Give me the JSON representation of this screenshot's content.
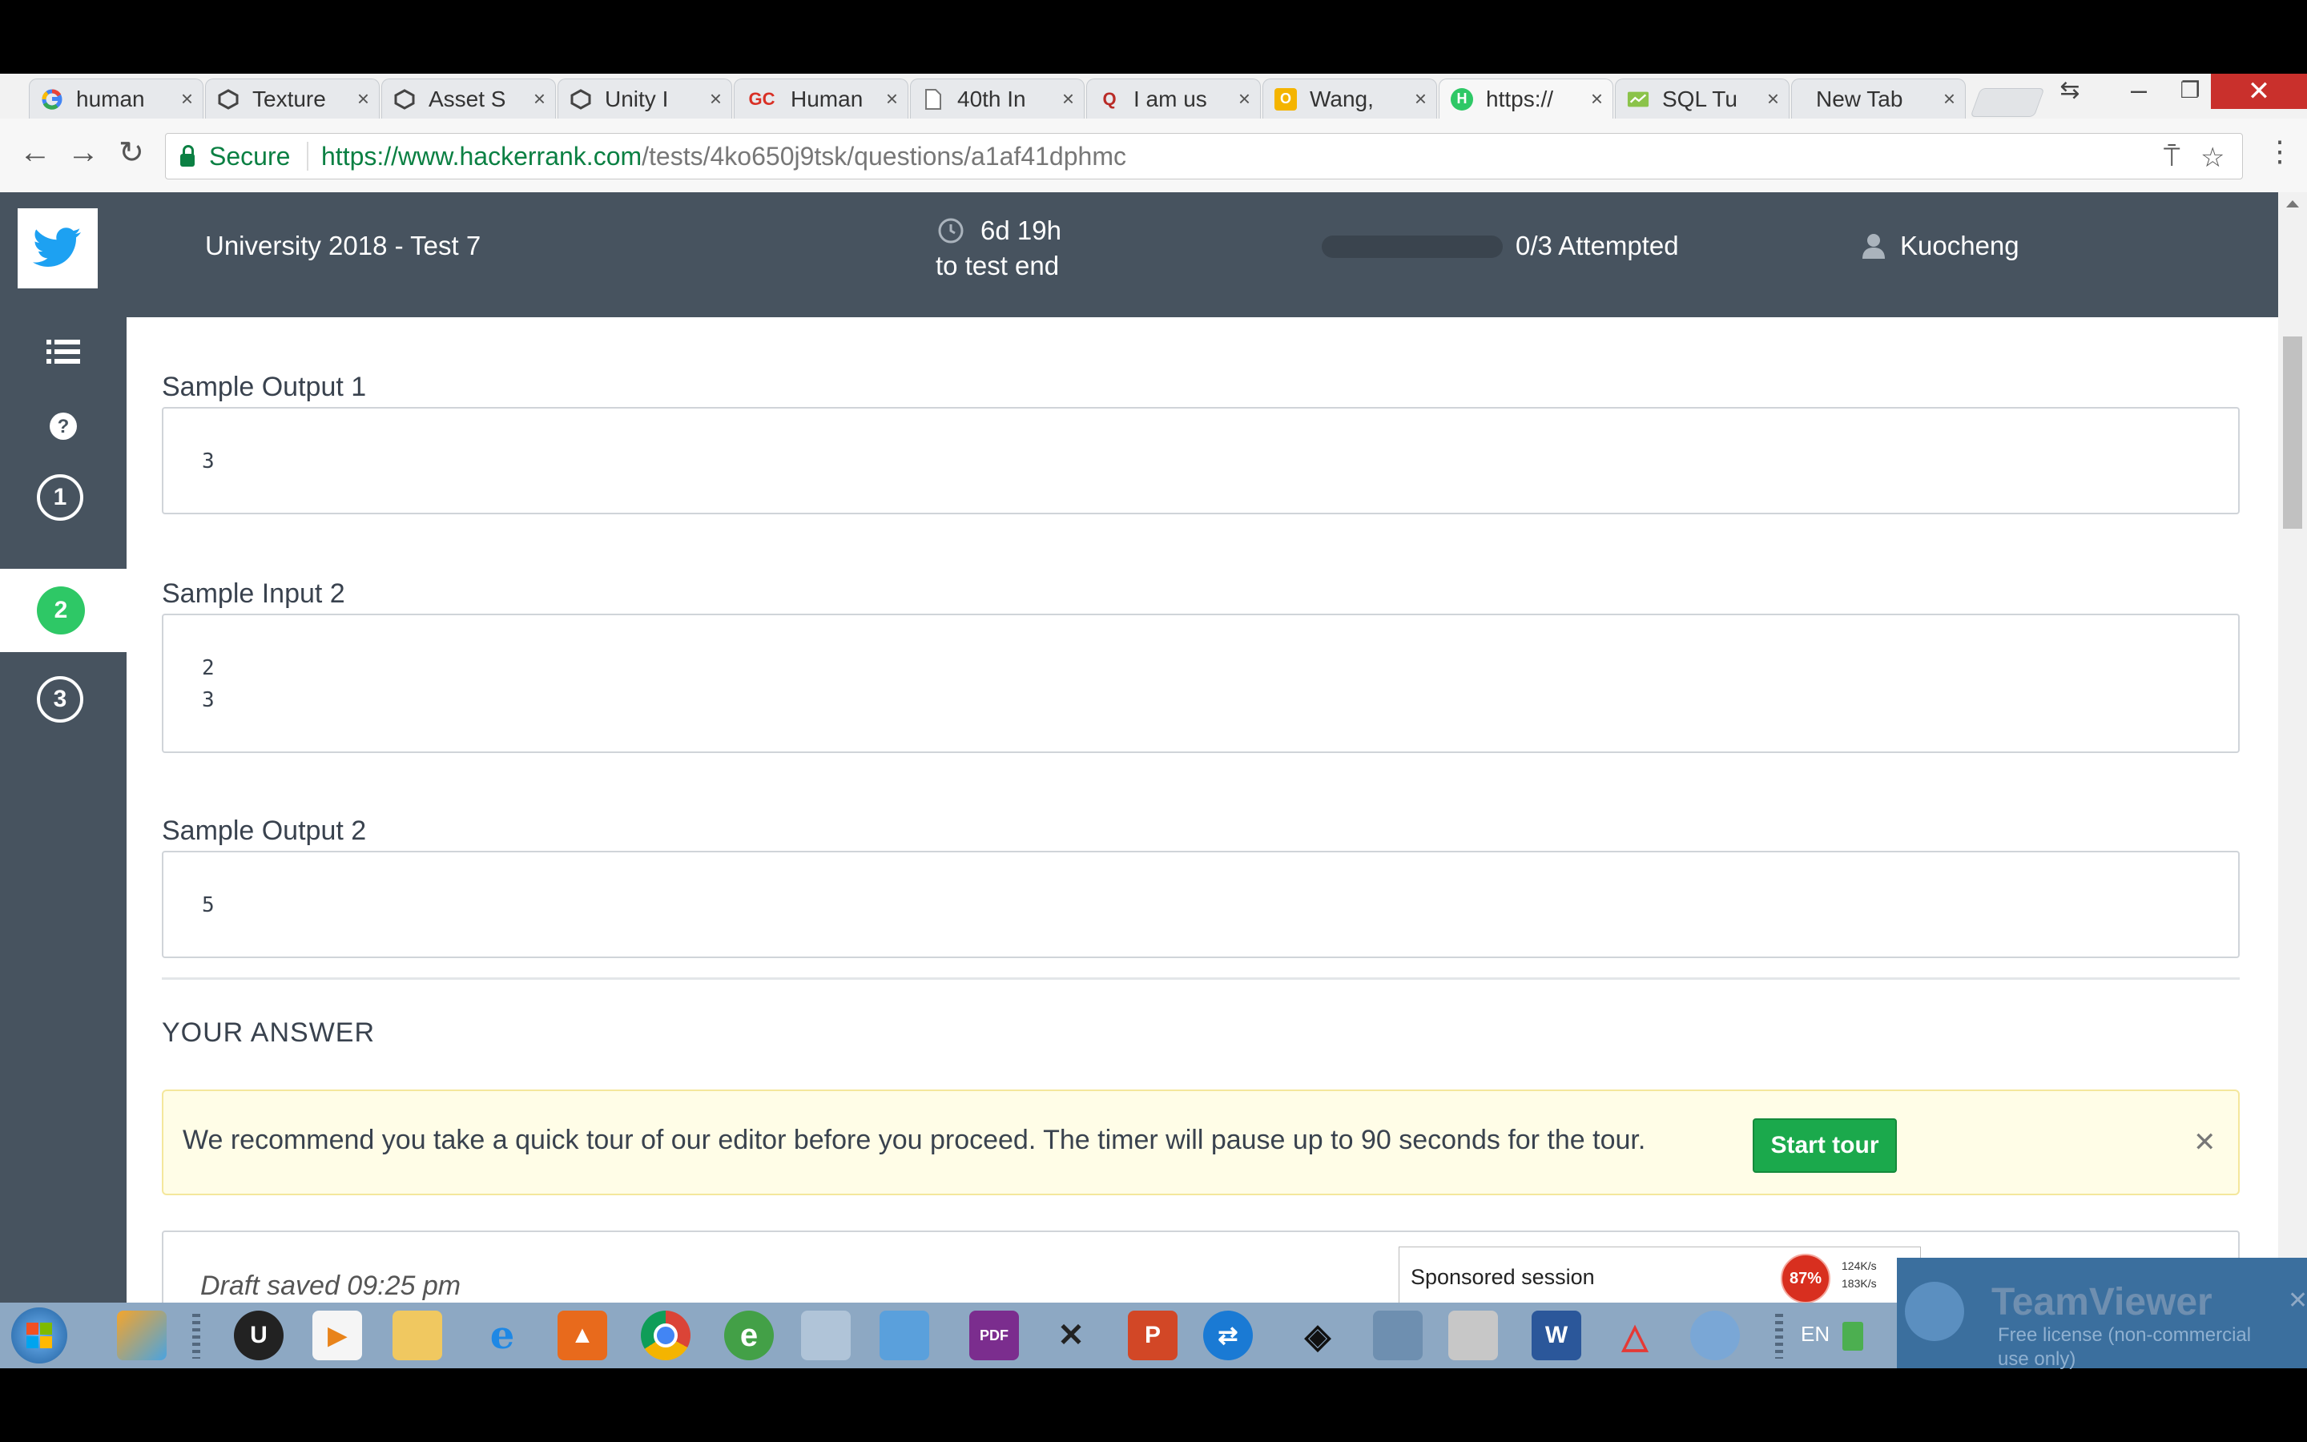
{
  "browser": {
    "tabs": [
      {
        "title": "human",
        "favicon": "google-icon"
      },
      {
        "title": "Texture",
        "favicon": "unity-icon"
      },
      {
        "title": "Asset S",
        "favicon": "unity-icon"
      },
      {
        "title": "Unity I",
        "favicon": "unity-icon"
      },
      {
        "title": "Human",
        "favicon": "gc-icon",
        "favicon_text": "GC"
      },
      {
        "title": "40th In",
        "favicon": "document-icon"
      },
      {
        "title": "I am us",
        "favicon": "quora-icon",
        "favicon_text": "Q"
      },
      {
        "title": "Wang,",
        "favicon": "outlook-icon",
        "favicon_text": "O"
      },
      {
        "title": "https://",
        "favicon": "hackerrank-icon",
        "favicon_text": "H",
        "active": true
      },
      {
        "title": "SQL Tu",
        "favicon": "sql-icon"
      },
      {
        "title": "New Tab",
        "favicon": ""
      }
    ],
    "close_glyph": "×",
    "security_label": "Secure",
    "url_domain": "https://www.hackerrank.com",
    "url_path": "/tests/4ko650j9tsk/questions/a1af41dphmc"
  },
  "header": {
    "test_title": "University 2018 - Test 7",
    "timer_value": "6d 19h",
    "timer_caption": "to test end",
    "progress": 0,
    "attempted": "0/3 Attempted",
    "username": "Kuocheng"
  },
  "sidebar": {
    "questions": [
      "1",
      "2",
      "3"
    ],
    "active_question": "2"
  },
  "content": {
    "sample_output_1": {
      "label": "Sample Output 1",
      "lines": [
        "3"
      ]
    },
    "sample_input_2": {
      "label": "Sample Input 2",
      "lines": [
        "2",
        "3"
      ]
    },
    "sample_output_2": {
      "label": "Sample Output 2",
      "lines": [
        "5"
      ]
    },
    "answer_heading": "YOUR ANSWER",
    "tour_message": "We recommend you take a quick tour of our editor before you proceed. The timer will pause up to 90 seconds for the tour.",
    "tour_button": "Start tour",
    "draft_status": "Draft saved 09:25 pm"
  },
  "overlay": {
    "sponsored_label": "Sponsored session",
    "cpu_gauge": "87%",
    "net_up": "124K/s",
    "net_down": "183K/s",
    "teamviewer_title": "TeamViewer",
    "teamviewer_subtitle": "Free license (non-commercial use only)"
  },
  "taskbar": {
    "language": "EN"
  },
  "colors": {
    "header_bg": "#47535f",
    "accent_green": "#2ec866",
    "button_green": "#1ba94c",
    "tour_bg": "#fffde7",
    "secure_green": "#0b8043"
  }
}
